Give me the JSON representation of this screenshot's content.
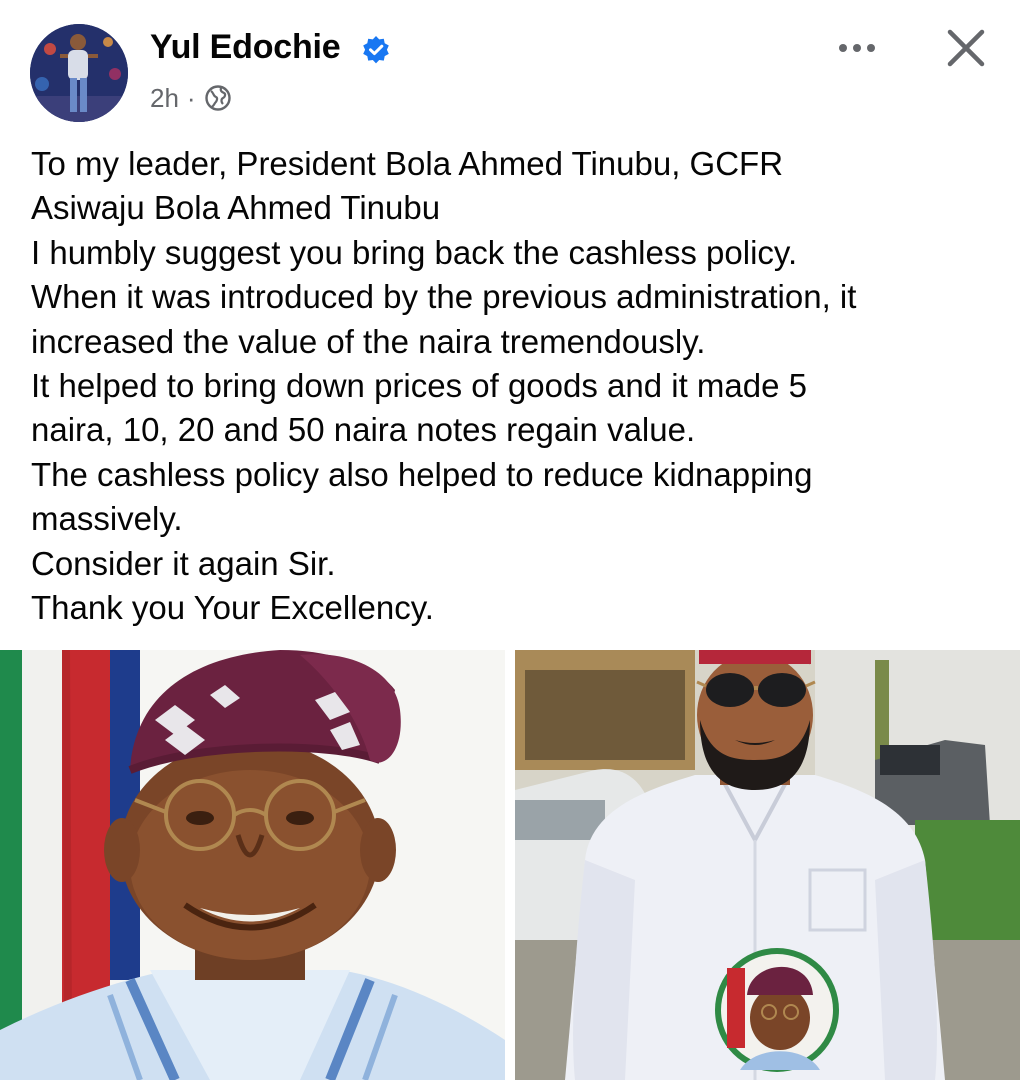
{
  "post": {
    "author_name": "Yul Edochie",
    "timestamp": "2h",
    "separator": "·",
    "audience_icon": "globe-icon",
    "verified_icon": "verified-badge-icon",
    "more_icon": "more-options-icon",
    "close_icon": "close-icon",
    "text_lines": [
      "To my leader, President Bola Ahmed Tinubu, GCFR",
      "Asiwaju Bola Ahmed Tinubu",
      "I humbly suggest you bring back the cashless policy.",
      "When it was introduced by the previous administration, it",
      "increased the value of the naira tremendously.",
      "It helped to bring down prices of goods and it made 5",
      "naira, 10, 20 and 50 naira notes regain value.",
      "The cashless policy also helped to reduce kidnapping",
      "massively.",
      "Consider it again Sir.",
      "Thank you Your Excellency."
    ]
  },
  "photos": [
    {
      "name": "photo-tinubu-portrait"
    },
    {
      "name": "photo-yul-edochie"
    }
  ],
  "colors": {
    "text": "#050505",
    "secondary_text": "#65676b",
    "verified_blue": "#1877f2",
    "cap_maroon": "#6b2240"
  }
}
